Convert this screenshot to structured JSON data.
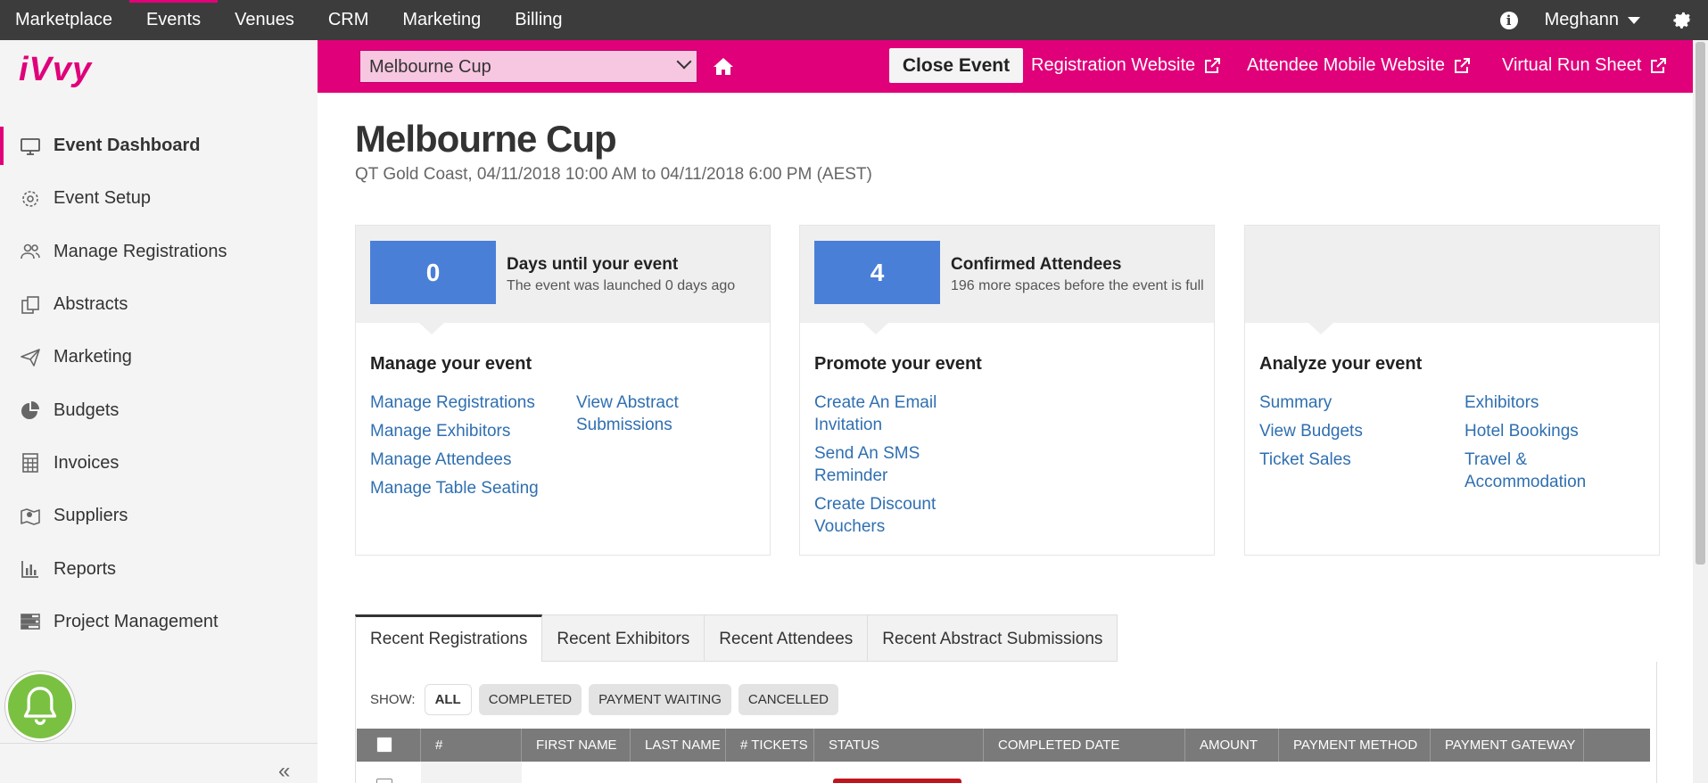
{
  "topnav": {
    "items": [
      "Marketplace",
      "Events",
      "Venues",
      "CRM",
      "Marketing",
      "Billing"
    ],
    "active": "Events",
    "user": "Meghann",
    "info_icon": "info-icon",
    "settings_icon": "gear-icon"
  },
  "sidebar": {
    "logo": "iVvy",
    "items": [
      {
        "label": "Event Dashboard",
        "icon": "monitor-icon"
      },
      {
        "label": "Event Setup",
        "icon": "gear-icon"
      },
      {
        "label": "Manage Registrations",
        "icon": "users-icon"
      },
      {
        "label": "Abstracts",
        "icon": "documents-icon"
      },
      {
        "label": "Marketing",
        "icon": "paper-plane-icon"
      },
      {
        "label": "Budgets",
        "icon": "pie-chart-icon"
      },
      {
        "label": "Invoices",
        "icon": "calculator-icon"
      },
      {
        "label": "Suppliers",
        "icon": "map-icon"
      },
      {
        "label": "Reports",
        "icon": "bar-chart-icon"
      },
      {
        "label": "Project Management",
        "icon": "tasks-icon"
      }
    ],
    "active": "Event Dashboard",
    "collapse_label": "«"
  },
  "eventbar": {
    "selected_event": "Melbourne Cup",
    "close_label": "Close Event",
    "links": [
      "Registration Website",
      "Attendee Mobile Website",
      "Virtual Run Sheet"
    ]
  },
  "page": {
    "title": "Melbourne Cup",
    "subtitle": "QT Gold Coast, 04/11/2018 10:00 AM to 04/11/2018 6:00 PM (AEST)"
  },
  "cards": [
    {
      "stat_value": "0",
      "stat_title": "Days until your event",
      "stat_desc": "The event was launched 0 days ago",
      "section": "Manage your event",
      "links_col1": [
        "Manage Registrations",
        "Manage Exhibitors",
        "Manage Attendees",
        "Manage Table Seating"
      ],
      "links_col2": [
        "View Abstract Submissions"
      ]
    },
    {
      "stat_value": "4",
      "stat_title": "Confirmed Attendees",
      "stat_desc": "196 more spaces before the event is full",
      "section": "Promote your event",
      "links_col1": [
        "Create An Email Invitation",
        "Send An SMS Reminder",
        "Create Discount Vouchers"
      ],
      "links_col2": []
    },
    {
      "stat_value": "",
      "stat_title": "",
      "stat_desc": "",
      "section": "Analyze your event",
      "links_col1": [
        "Summary",
        "View Budgets",
        "Ticket Sales"
      ],
      "links_col2": [
        "Exhibitors",
        "Hotel Bookings",
        "Travel & Accommodation"
      ]
    }
  ],
  "tabs": {
    "items": [
      "Recent Registrations",
      "Recent Exhibitors",
      "Recent Attendees",
      "Recent Abstract Submissions"
    ],
    "active": "Recent Registrations"
  },
  "filters": {
    "label": "SHOW:",
    "options": [
      "ALL",
      "COMPLETED",
      "PAYMENT WAITING",
      "CANCELLED"
    ],
    "active": "ALL"
  },
  "table": {
    "columns": [
      "#",
      "FIRST NAME",
      "LAST NAME",
      "# TICKETS",
      "STATUS",
      "COMPLETED DATE",
      "AMOUNT",
      "PAYMENT METHOD",
      "PAYMENT GATEWAY"
    ]
  },
  "colors": {
    "brand": "#e0007a",
    "stat_box": "#4a7fd8",
    "link": "#2f6fb1",
    "nav_bg": "#3c3c3c",
    "status_cancelled": "#c0151e",
    "bell": "#7ac142"
  }
}
